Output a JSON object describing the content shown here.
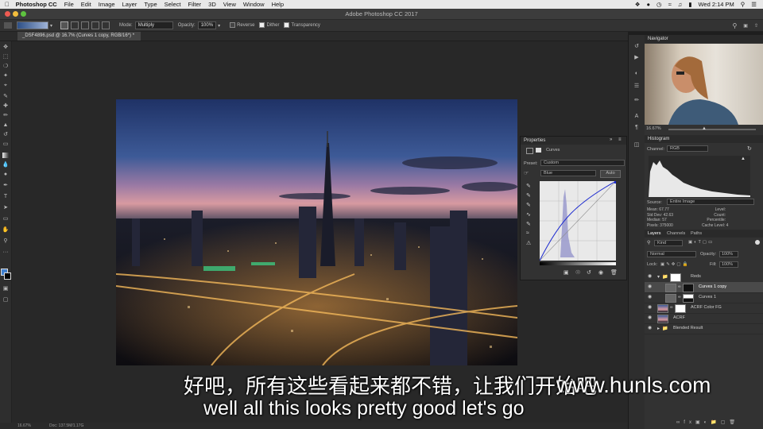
{
  "menubar": {
    "items": [
      "Photoshop CC",
      "File",
      "Edit",
      "Image",
      "Layer",
      "Type",
      "Select",
      "Filter",
      "3D",
      "View",
      "Window",
      "Help"
    ],
    "clock": "Wed 2:14 PM"
  },
  "window": {
    "title": "Adobe Photoshop CC 2017"
  },
  "options": {
    "mode_label": "Mode:",
    "mode_value": "Multiply",
    "opacity_label": "Opacity:",
    "opacity_value": "100%",
    "reverse": "Reverse",
    "dither": "Dither",
    "transparency": "Transparency"
  },
  "document": {
    "tab": "_DSF4896.psd @ 16.7% (Curves 1 copy, RGB/16*) *",
    "zoom": "16.67%",
    "doc_info": "Doc: 137.5M/1.17G"
  },
  "properties": {
    "title": "Properties",
    "type": "Curves",
    "preset_label": "Preset:",
    "preset_value": "Custom",
    "channel_value": "Blue",
    "auto": "Auto"
  },
  "navigator": {
    "title": "Navigator",
    "zoom": "16.67%"
  },
  "histogram": {
    "title": "Histogram",
    "channel_label": "Channel:",
    "channel_value": "RGB",
    "source_label": "Source:",
    "source_value": "Entire Image",
    "mean_label": "Mean:",
    "mean": "67.77",
    "stddev_label": "Std Dev:",
    "stddev": "42.63",
    "median_label": "Median:",
    "median": "57",
    "pixels_label": "Pixels:",
    "pixels": "375000",
    "level_label": "Level:",
    "count_label": "Count:",
    "percentile_label": "Percentile:",
    "cache_label": "Cache Level:",
    "cache": "4"
  },
  "layers": {
    "tabs": [
      "Layers",
      "Channels",
      "Paths"
    ],
    "kind": "Kind",
    "blend": "Normal",
    "opacity_label": "Opacity:",
    "opacity": "100%",
    "lock_label": "Lock:",
    "fill_label": "Fill:",
    "fill": "100%",
    "rows": [
      {
        "name": "Reds"
      },
      {
        "name": "Curves 1 copy"
      },
      {
        "name": "Curves 1"
      },
      {
        "name": "ACRF Color FG"
      },
      {
        "name": "ACRF"
      },
      {
        "name": "Blended Result"
      }
    ]
  },
  "subtitles": {
    "chinese": "好吧，所有这些看起来都不错，让我们开始吧",
    "english": "well all this looks pretty good let's go",
    "watermark": "www.hunls.com"
  },
  "colors": {
    "accent": "#2d6bcb",
    "panel": "#323232"
  }
}
